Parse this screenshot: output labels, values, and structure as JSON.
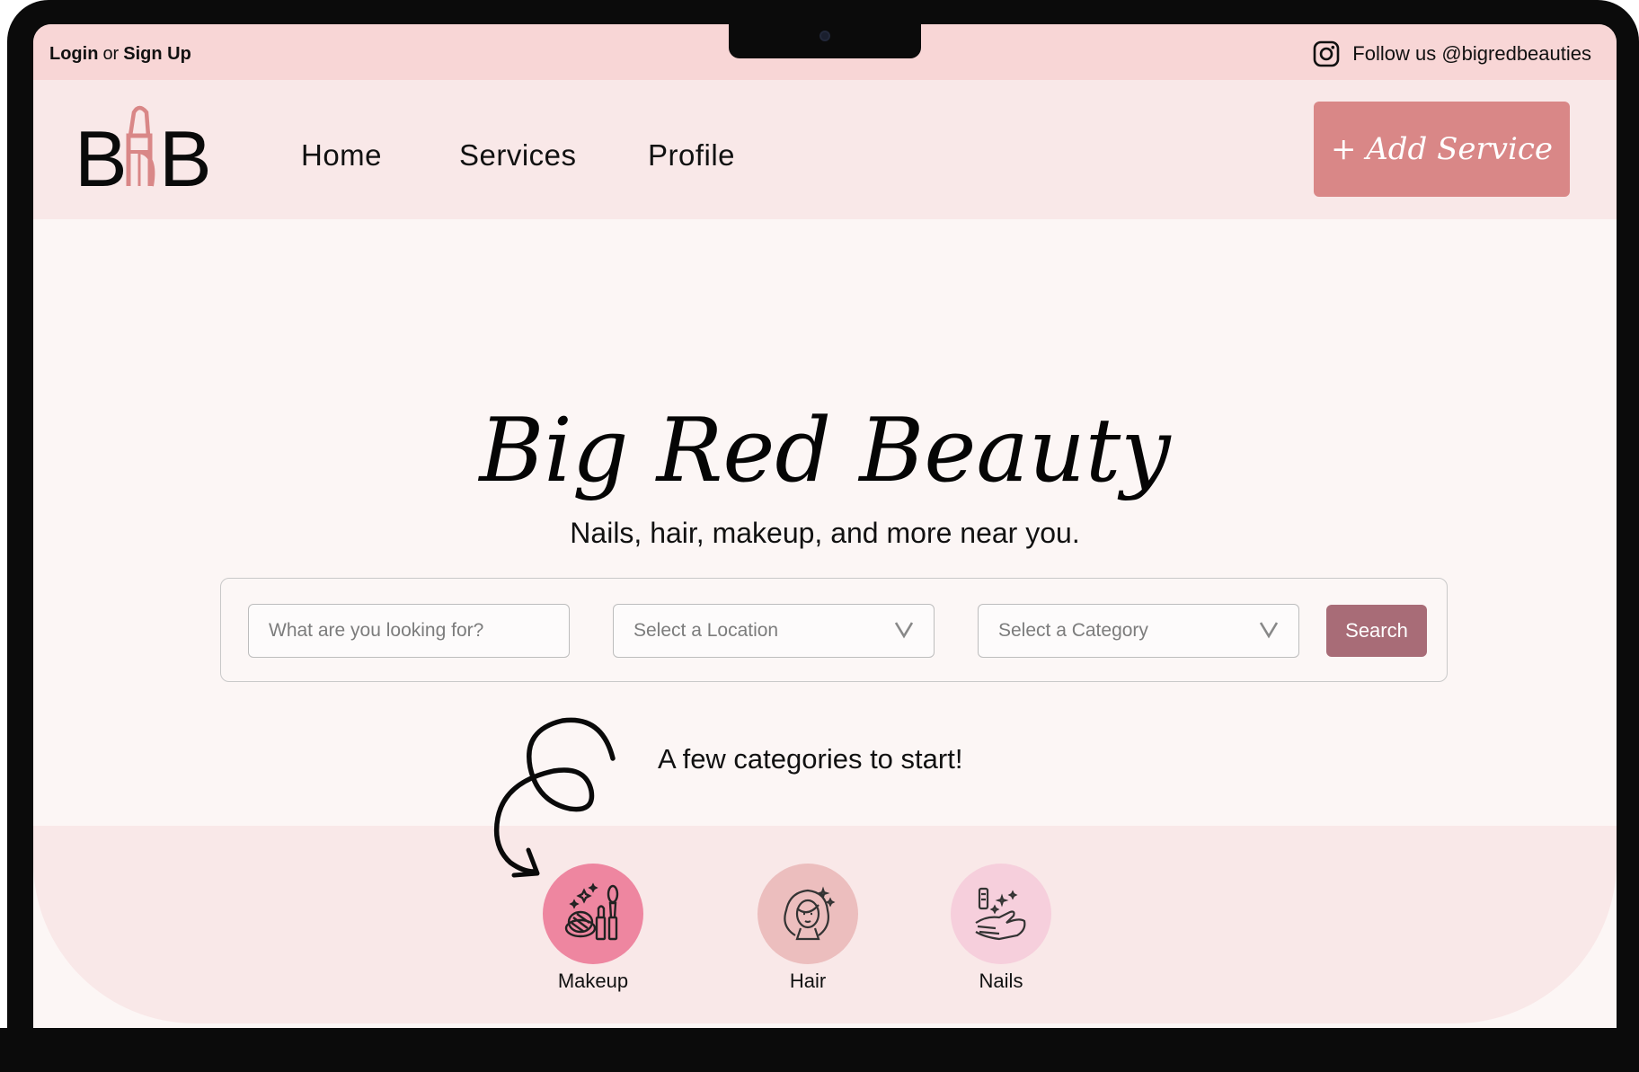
{
  "topbar": {
    "login": "Login",
    "or": "or",
    "signup": "Sign Up",
    "follow": "Follow us @bigredbeauties",
    "instagram_icon": "instagram-icon"
  },
  "nav": {
    "logo_text": "BRB",
    "links": [
      "Home",
      "Services",
      "Profile"
    ],
    "add_service": "+ Add Service"
  },
  "hero": {
    "title": "Big Red Beauty",
    "subtitle": "Nails, hair, makeup, and more near you."
  },
  "search": {
    "query_placeholder": "What are you looking for?",
    "location_placeholder": "Select a Location",
    "category_placeholder": "Select a Category",
    "button": "Search"
  },
  "categories": {
    "heading": "A few categories to start!",
    "items": [
      {
        "label": "Makeup",
        "icon": "makeup-icon",
        "color": "#ee86a0"
      },
      {
        "label": "Hair",
        "icon": "hair-icon",
        "color": "#ecbebe"
      },
      {
        "label": "Nails",
        "icon": "nails-icon",
        "color": "#f6cfdc"
      }
    ]
  },
  "colors": {
    "accent": "#d98787",
    "search_button": "#a86c77",
    "topbar_bg": "#f8d6d6",
    "nav_bg": "#f9e8e8",
    "page_bg": "#fcf6f5"
  }
}
